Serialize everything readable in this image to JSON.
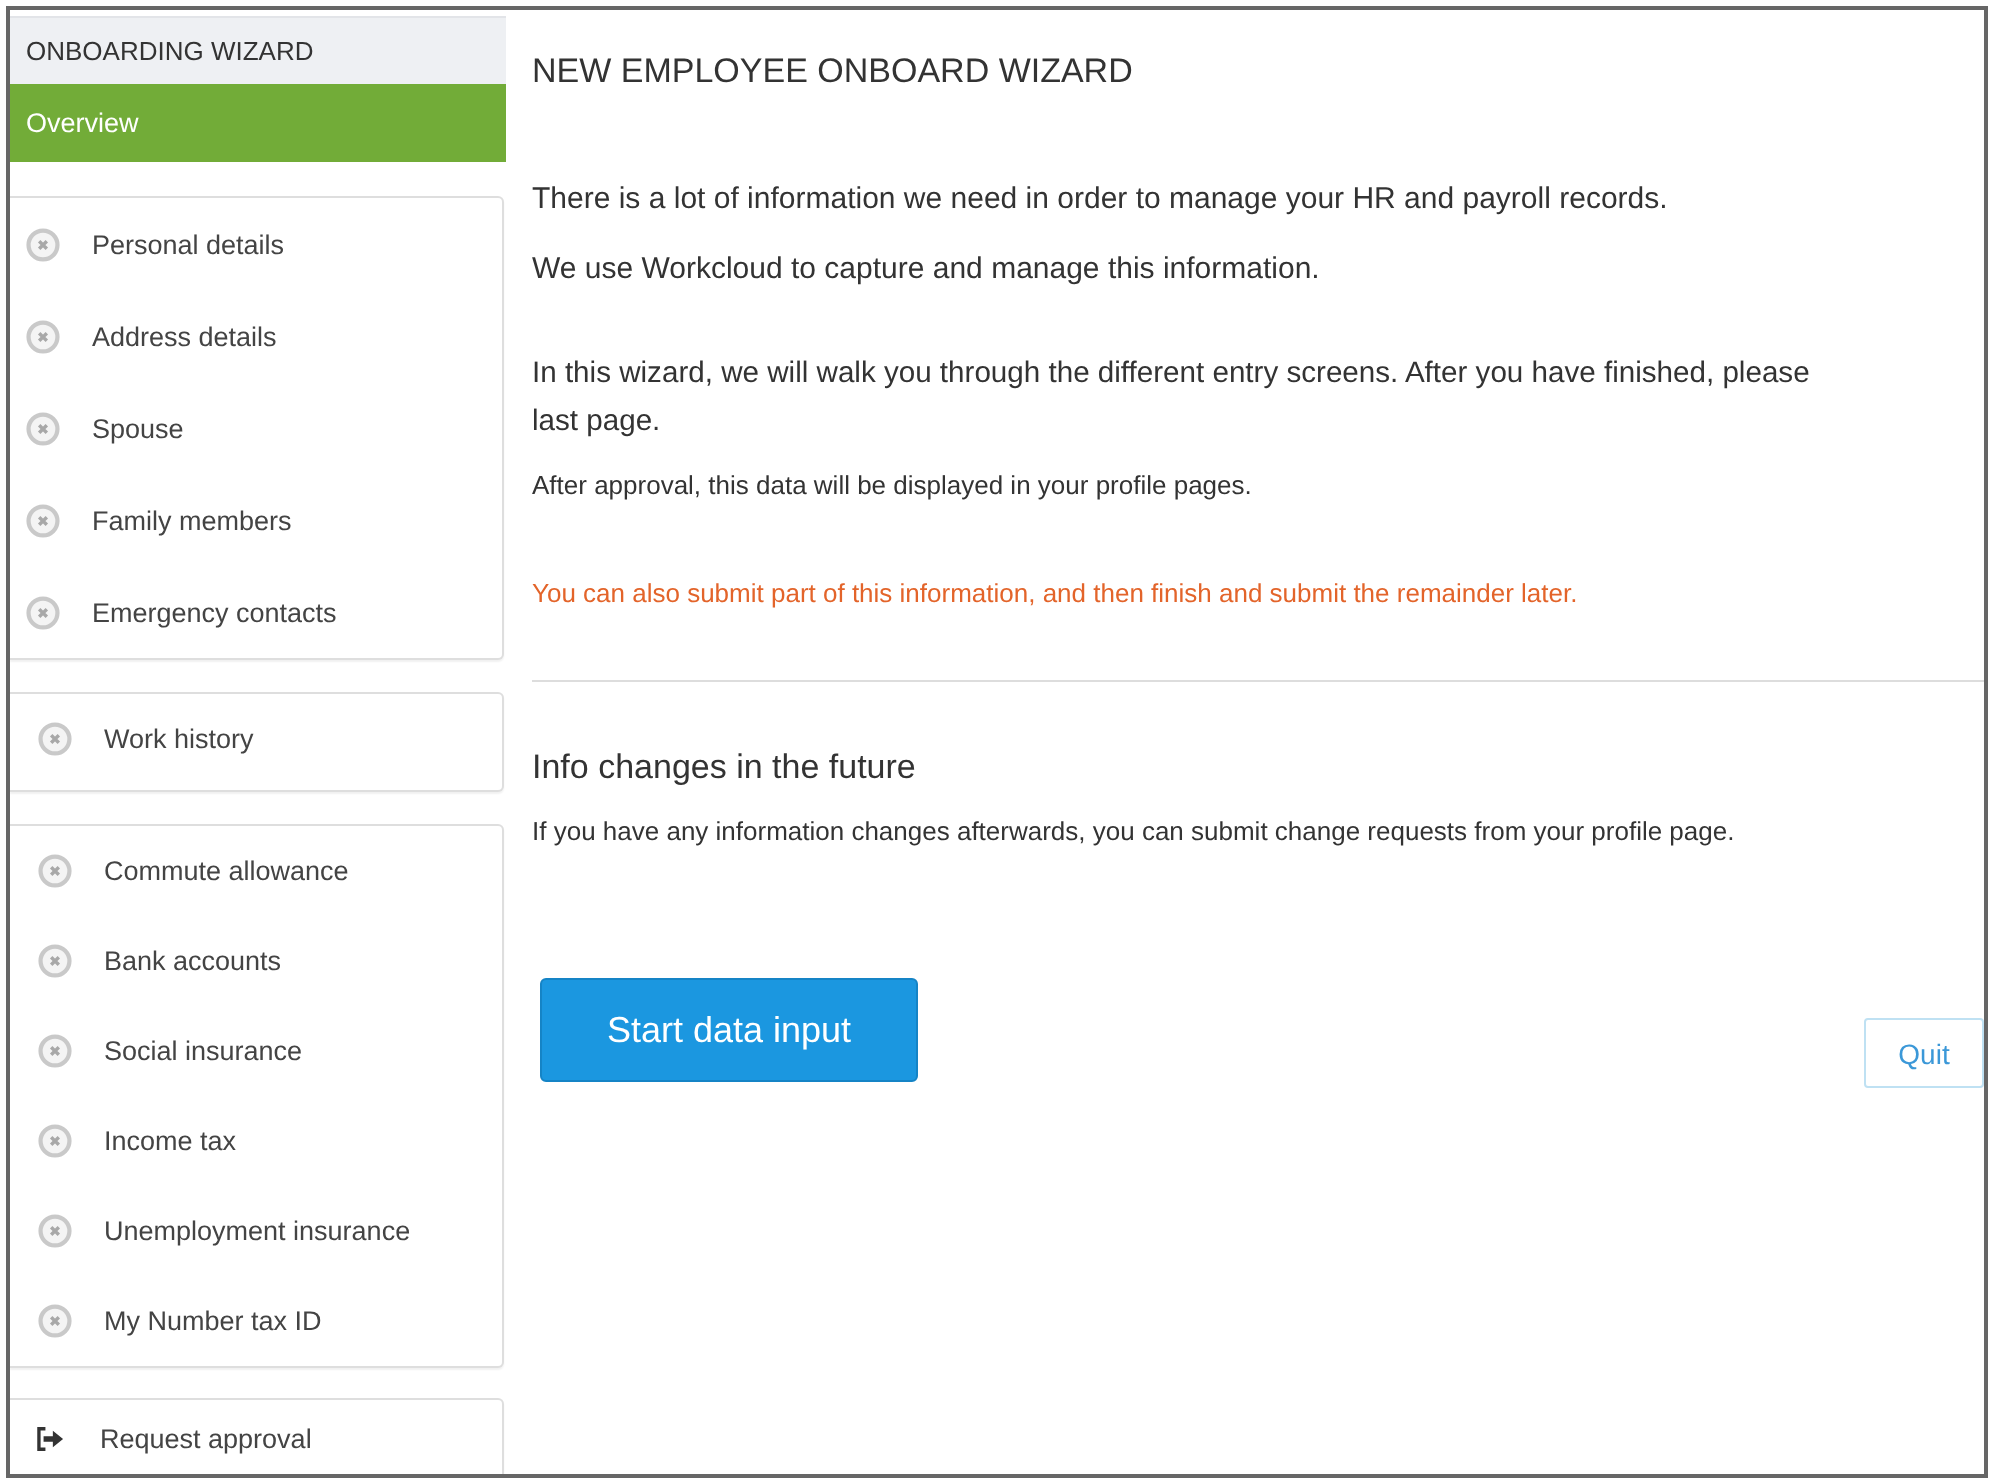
{
  "sidebar": {
    "title": "ONBOARDING WIZARD",
    "overview": {
      "label": "Overview",
      "selected": true
    },
    "groups": [
      {
        "steps": [
          {
            "label": "Personal details",
            "completed": false,
            "selected": false
          },
          {
            "label": "Address details",
            "completed": false,
            "selected": false
          },
          {
            "label": "Spouse",
            "completed": false,
            "selected": false
          },
          {
            "label": "Family members",
            "completed": false,
            "selected": false
          },
          {
            "label": "Emergency contacts",
            "completed": false,
            "selected": false
          }
        ]
      },
      {
        "steps": [
          {
            "label": "Work history",
            "completed": false,
            "selected": false
          }
        ]
      },
      {
        "steps": [
          {
            "label": "Commute allowance",
            "completed": false,
            "selected": false
          },
          {
            "label": "Bank accounts",
            "completed": false,
            "selected": false
          },
          {
            "label": "Social insurance",
            "completed": false,
            "selected": false
          },
          {
            "label": "Income tax",
            "completed": false,
            "selected": false
          },
          {
            "label": "Unemployment insurance",
            "completed": false,
            "selected": false
          },
          {
            "label": "My Number tax ID",
            "completed": false,
            "selected": false
          }
        ]
      }
    ],
    "action": {
      "label": "Request approval"
    }
  },
  "main": {
    "title": "NEW EMPLOYEE ONBOARD WIZARD",
    "paragraphs": [
      {
        "kind": "body",
        "text": "There is a lot of information we need in order to manage your HR and payroll records."
      },
      {
        "kind": "body",
        "text": "We use Workcloud to capture and manage this information."
      },
      {
        "kind": "body",
        "text": "In this wizard, we will walk you through the different entry screens. After you have finished, please\nlast page."
      },
      {
        "kind": "small",
        "text": "After approval, this data will be displayed in your profile pages."
      },
      {
        "kind": "notice",
        "text": "You can also submit part of this information, and then finish and submit the remainder later."
      }
    ],
    "section": {
      "title": "Info changes in the future",
      "text": "If you have any information changes afterwards, you can submit change requests from your profile page."
    },
    "primary_button": "Start data input",
    "quit_button": "Quit"
  }
}
